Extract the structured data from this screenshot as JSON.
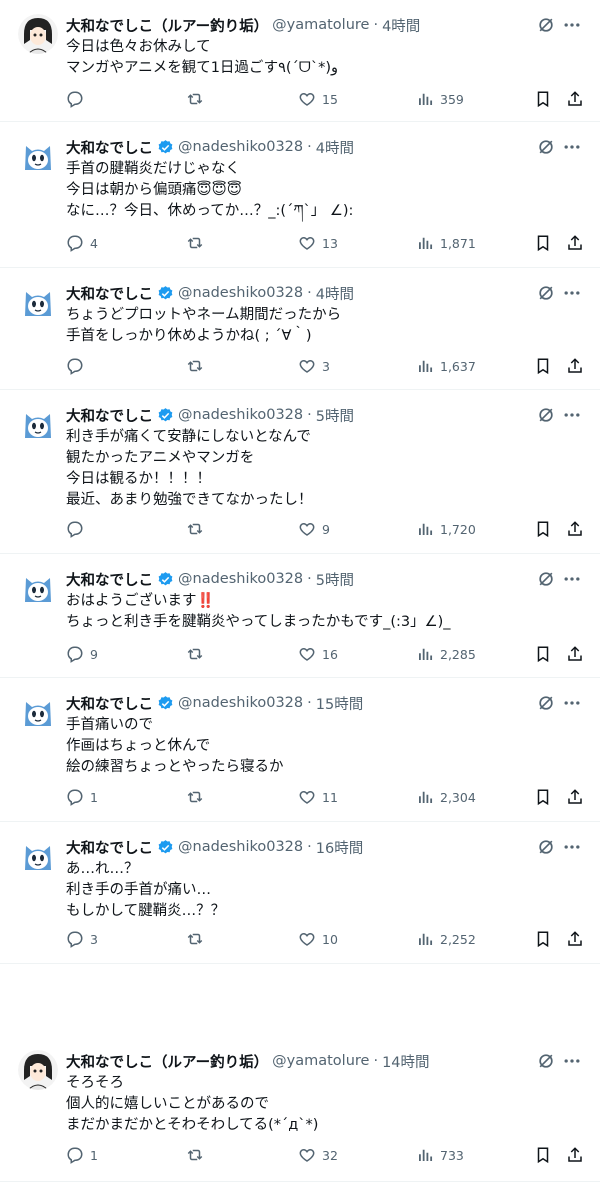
{
  "tweets": [
    {
      "name": "大和なでしこ（ルアー釣り垢）",
      "handle": "@yamatolure",
      "time": "4時間",
      "verified": false,
      "avatar": "anime-girl",
      "text": "今日は色々お休みして\nマンガやアニメを観て1日過ごす٩(´ᗜ`*)و",
      "replies": "",
      "likes": "15",
      "views": "359"
    },
    {
      "name": "大和なでしこ",
      "handle": "@nadeshiko0328",
      "time": "4時間",
      "verified": true,
      "avatar": "blue-cat",
      "text": "手首の腱鞘炎だけじゃなく\n今日は朝から偏頭痛😇😇😇\nなに…？今日、休めってか…？_:(´ཀ`」 ∠):",
      "replies": "4",
      "likes": "13",
      "views": "1,871"
    },
    {
      "name": "大和なでしこ",
      "handle": "@nadeshiko0328",
      "time": "4時間",
      "verified": true,
      "avatar": "blue-cat",
      "text": "ちょうどプロットやネーム期間だったから\n手首をしっかり休めようかね( ; ´∀｀)",
      "replies": "",
      "likes": "3",
      "views": "1,637"
    },
    {
      "name": "大和なでしこ",
      "handle": "@nadeshiko0328",
      "time": "5時間",
      "verified": true,
      "avatar": "blue-cat",
      "text": "利き手が痛くて安静にしないとなんで\n観たかったアニメやマンガを\n今日は観るか！！！！\n最近、あまり勉強できてなかったし！",
      "replies": "",
      "likes": "9",
      "views": "1,720"
    },
    {
      "name": "大和なでしこ",
      "handle": "@nadeshiko0328",
      "time": "5時間",
      "verified": true,
      "avatar": "blue-cat",
      "text": "おはようございます‼️\nちょっと利き手を腱鞘炎やってしまったかもです_(:3」∠)_",
      "replies": "9",
      "likes": "16",
      "views": "2,285"
    },
    {
      "name": "大和なでしこ",
      "handle": "@nadeshiko0328",
      "time": "15時間",
      "verified": true,
      "avatar": "blue-cat",
      "text": "手首痛いので\n作画はちょっと休んで\n絵の練習ちょっとやったら寝るか",
      "replies": "1",
      "likes": "11",
      "views": "2,304"
    },
    {
      "name": "大和なでしこ",
      "handle": "@nadeshiko0328",
      "time": "16時間",
      "verified": true,
      "avatar": "blue-cat",
      "text": "あ…れ…？\n利き手の手首が痛い…\nもしかして腱鞘炎…？？",
      "replies": "3",
      "likes": "10",
      "views": "2,252"
    },
    {
      "name": "大和なでしこ（ルアー釣り垢）",
      "handle": "@yamatolure",
      "time": "14時間",
      "verified": false,
      "avatar": "anime-girl",
      "text": "そろそろ\n個人的に嬉しいことがあるので\nまだかまだかとそわそわしてる(*´д`*)",
      "replies": "1",
      "likes": "32",
      "views": "733"
    }
  ],
  "icons": {
    "reply": "reply-icon",
    "retweet": "retweet-icon",
    "like": "heart-icon",
    "views": "views-icon",
    "bookmark": "bookmark-icon",
    "share": "share-icon",
    "grok": "grok-icon",
    "more": "more-icon"
  },
  "colors": {
    "verified": "#1d9bf0",
    "muted": "#536471",
    "text": "#0f1419",
    "cat": "#5b9bd5"
  }
}
